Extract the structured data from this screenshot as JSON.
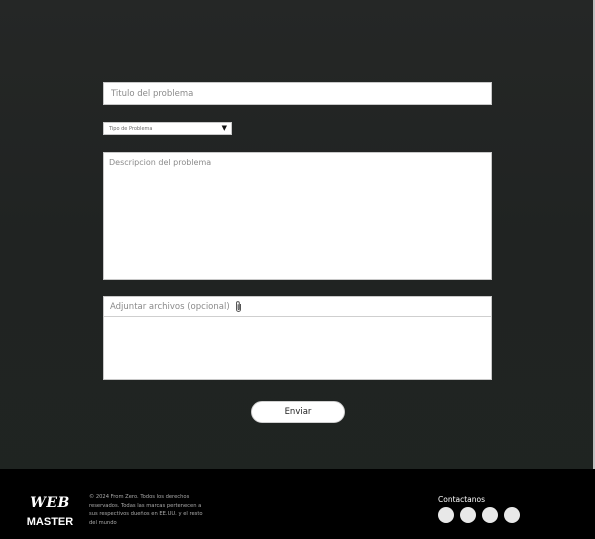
{
  "form": {
    "title_placeholder": "Titulo del problema",
    "type_select_value": "Tipo de Problema",
    "description_placeholder": "Descripcion del problema",
    "attach_label": "Adjuntar archivos (opcional)",
    "submit_label": "Enviar"
  },
  "footer": {
    "logo_top": "WEB",
    "logo_bottom": "MASTER",
    "copyright_lines": [
      "© 2024 From Zero. Todos los derechos",
      "reservados. Todas las marcas pertenecen a",
      "sus respectivos dueños en EE.UU. y el resto",
      "del mundo"
    ],
    "contact_title": "Contactanos",
    "social_icons": [
      "social-icon-1",
      "social-icon-2",
      "social-icon-3",
      "social-icon-4"
    ]
  }
}
